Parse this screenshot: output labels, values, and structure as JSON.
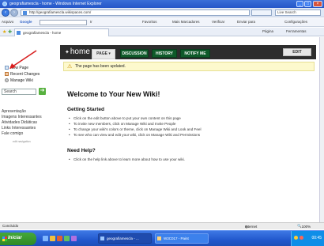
{
  "window": {
    "title": "geografiamescla - home - Windows Internet Explorer"
  },
  "addressbar": {
    "url": "http://geografiamescla.wikispaces.com/",
    "search_engine": "Live Search"
  },
  "toolbar": {
    "file_menu": "Arquivo",
    "google_label": "Google",
    "go_label": "Ir",
    "favorites": "Favoritos",
    "bookmarks": "Mais Marcadores",
    "check": "Verificar",
    "send_to": "Enviar para",
    "settings": "Configurações"
  },
  "tabs": {
    "current": "geografiamescla - home",
    "page_menu": "Página",
    "tools_menu": "Ferramentas"
  },
  "header": {
    "site_title": "home",
    "nav": [
      {
        "label": "PAGE",
        "active": true
      },
      {
        "label": "DISCUSSION",
        "active": false
      },
      {
        "label": "HISTORY",
        "active": false
      },
      {
        "label": "NOTIFY ME",
        "active": false
      }
    ],
    "edit_label": "EDIT"
  },
  "notice": {
    "text": "The page has been updated."
  },
  "sidebar": {
    "actions": [
      {
        "label": "New Page",
        "icon": "new-page-icon"
      },
      {
        "label": "Recent Changes",
        "icon": "recent-changes-icon"
      },
      {
        "label": "Manage Wiki",
        "icon": "manage-wiki-icon"
      }
    ],
    "search_placeholder": "Search",
    "links": [
      "Apresentação",
      "Imagens Interessantes",
      "Atividades Didáticas",
      "Links Interessantes",
      "Fale comigo"
    ],
    "edit_navigation": "edit navigation"
  },
  "content": {
    "welcome": "Welcome to Your New Wiki!",
    "getting_started": {
      "heading": "Getting Started",
      "bullets": [
        "Click on the edit button above to put your own content on this page",
        "To invite new members, click on Manage Wiki and Invite People",
        "To change your wiki's colors or theme, click on Manage Wiki and Look and Feel",
        "To see who can view and edit your wiki, click on Manage Wiki and Permissions"
      ]
    },
    "need_help": {
      "heading": "Need Help?",
      "bullets": [
        "Click on the help link above to learn more about how to use your wiki."
      ]
    }
  },
  "statusbar": {
    "left": "Concluído",
    "zone": "Internet",
    "zoom": "100%"
  },
  "taskbar": {
    "start": "Iniciar",
    "items": [
      {
        "label": "geografiamescla - ...",
        "active": true
      },
      {
        "label": "W3C017 - Paint",
        "active": false
      }
    ],
    "clock": "00:45"
  },
  "colors": {
    "nav_tab_green": "#0f5a2a",
    "header_dark": "#2d2d2d",
    "notice_bg": "#fdf9cd",
    "arrow_red": "#d81f1f"
  }
}
